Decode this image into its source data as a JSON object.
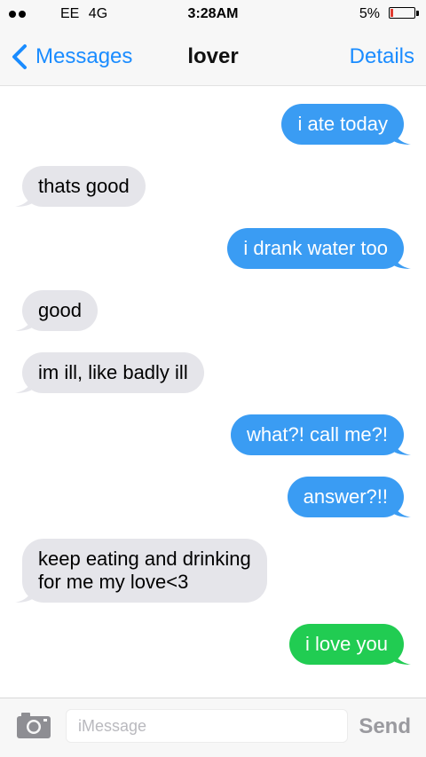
{
  "status_bar": {
    "carrier": "EE",
    "network": "4G",
    "time": "3:28AM",
    "battery_percent": "5%",
    "battery_level": 0.05,
    "battery_color": "#e03a2f"
  },
  "nav": {
    "back_label": "Messages",
    "back_icon": "chevron-left-icon",
    "title": "lover",
    "details_label": "Details"
  },
  "messages": [
    {
      "direction": "sent",
      "text": "i ate today"
    },
    {
      "direction": "received",
      "text": "thats good"
    },
    {
      "direction": "sent",
      "text": "i drank water too"
    },
    {
      "direction": "received",
      "text": "good"
    },
    {
      "direction": "received",
      "text": "im ill, like badly ill"
    },
    {
      "direction": "sent",
      "text": "what?! call me?!"
    },
    {
      "direction": "sent",
      "text": "answer?!!"
    },
    {
      "direction": "received",
      "text": "keep eating and drinking\nfor me my love<3"
    },
    {
      "direction": "sent",
      "text": "i love you",
      "color": "#21cc52"
    }
  ],
  "colors": {
    "sent_bubble": "#3a9cf3",
    "received_bubble": "#e5e5ea",
    "accent": "#1a8cff"
  },
  "input_bar": {
    "camera_icon": "camera-icon",
    "placeholder": "iMessage",
    "value": "",
    "send_label": "Send"
  }
}
